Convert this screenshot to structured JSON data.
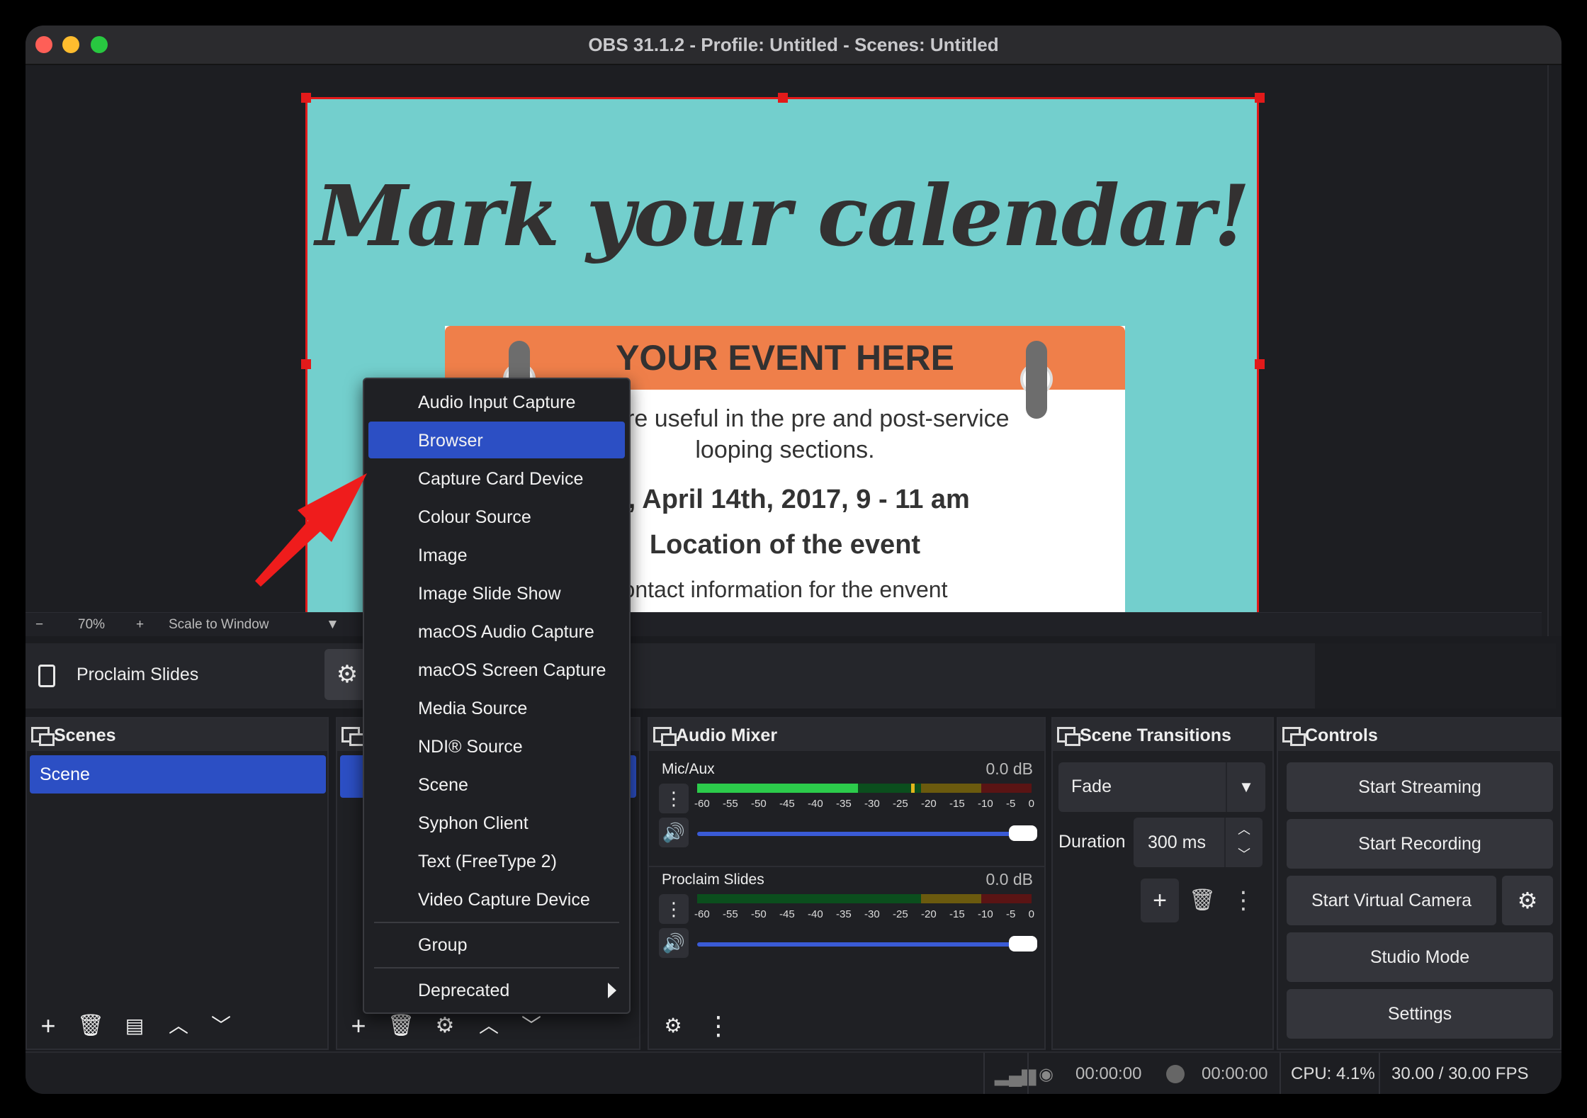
{
  "window": {
    "title": "OBS 31.1.2 - Profile: Untitled - Scenes: Untitled"
  },
  "preview": {
    "slide": {
      "title": "Mark your calendar!",
      "event_heading": "YOUR EVENT HERE",
      "line1": "ents are useful in the pre and post-service",
      "line2": "looping sections.",
      "date": "ay, April 14th, 2017, 9 - 11 am",
      "location": "Location of the event",
      "contact": "ontact information for the envent"
    },
    "zoom": {
      "minus": "−",
      "value": "70%",
      "plus": "+",
      "mode": "Scale to Window",
      "dropdown": "▼"
    }
  },
  "source_toolbar": {
    "name": "Proclaim Slides",
    "gear": "⚙"
  },
  "scenes": {
    "title": "Scenes",
    "items": [
      "Scene"
    ]
  },
  "audio_mixer": {
    "title": "Audio Mixer",
    "tracks": [
      {
        "name": "Mic/Aux",
        "db": "0.0 dB"
      },
      {
        "name": "Proclaim Slides",
        "db": "0.0 dB"
      }
    ],
    "scale": [
      "-60",
      "-55",
      "-50",
      "-45",
      "-40",
      "-35",
      "-30",
      "-25",
      "-20",
      "-15",
      "-10",
      "-5",
      "0"
    ]
  },
  "scene_transitions": {
    "title": "Scene Transitions",
    "transition": "Fade",
    "duration_label": "Duration",
    "duration_value": "300 ms"
  },
  "controls": {
    "title": "Controls",
    "start_streaming": "Start Streaming",
    "start_recording": "Start Recording",
    "start_virtual_camera": "Start Virtual Camera",
    "studio_mode": "Studio Mode",
    "settings": "Settings"
  },
  "context_menu": {
    "items": [
      "Audio Input Capture",
      "Browser",
      "Capture Card Device",
      "Colour Source",
      "Image",
      "Image Slide Show",
      "macOS Audio Capture",
      "macOS Screen Capture",
      "Media Source",
      "NDI® Source",
      "Scene",
      "Syphon Client",
      "Text (FreeType 2)",
      "Video Capture Device"
    ],
    "group": "Group",
    "deprecated": "Deprecated",
    "highlighted": "Browser"
  },
  "status": {
    "stream_time": "00:00:00",
    "record_time": "00:00:00",
    "cpu": "CPU: 4.1%",
    "fps": "30.00 / 30.00 FPS"
  },
  "colors": {
    "accent": "#2c4fc4",
    "handle_red": "#e21a1a",
    "arrow_red": "#ef1c1c"
  }
}
